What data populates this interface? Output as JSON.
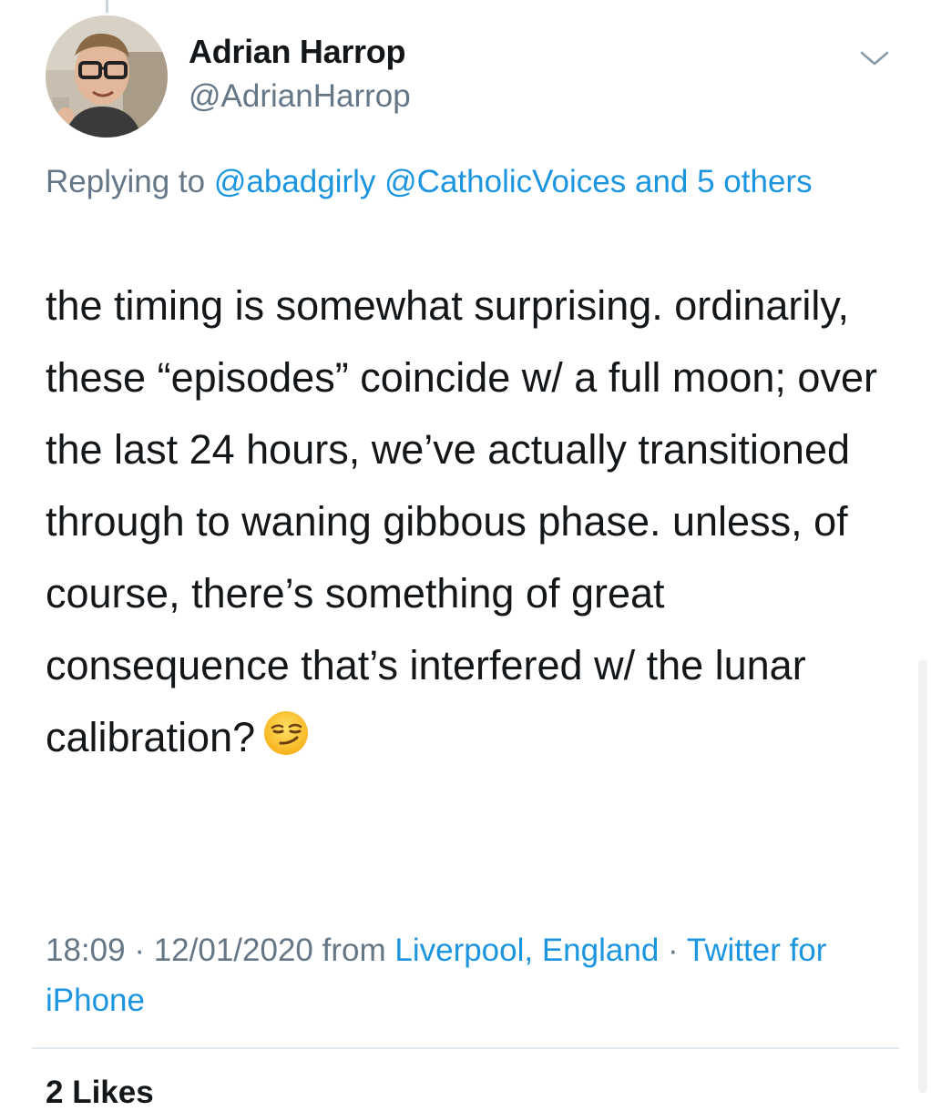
{
  "author": {
    "name": "Adrian Harrop",
    "handle": "@AdrianHarrop"
  },
  "reply": {
    "prefix": "Replying to",
    "mentions": [
      "@abadgirly",
      "@CatholicVoices"
    ],
    "others": "and 5 others"
  },
  "tweet": {
    "text": "the timing is somewhat surprising. ordinarily, these “episodes” coincide w/ a full moon; over the last 24 hours, we’ve actually transitioned through to waning gibbous phase. unless, of course, there’s something of great consequence that’s interfered w/ the lunar calibration?",
    "emoji": "smirking-face"
  },
  "meta": {
    "time": "18:09",
    "sep1": "·",
    "date": "12/01/2020",
    "from_word": "from",
    "location": "Liverpool, England",
    "sep2": "·",
    "source": "Twitter for iPhone"
  },
  "stats": {
    "likes_label": "2 Likes"
  },
  "colors": {
    "link": "#1b95e0",
    "secondary_text": "#657786",
    "primary_text": "#14171a",
    "divider": "#e1e8ed"
  }
}
